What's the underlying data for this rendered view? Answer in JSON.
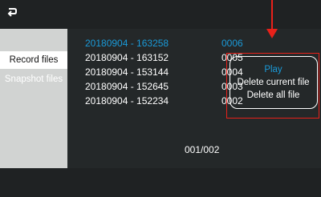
{
  "sidebar": {
    "tabs": [
      {
        "label": "Record files",
        "active": true
      },
      {
        "label": "Snapshot files",
        "active": false
      }
    ]
  },
  "files": [
    {
      "name": "20180904 - 163258",
      "index": "0006",
      "selected": true
    },
    {
      "name": "20180904 - 163152",
      "index": "0005",
      "selected": false
    },
    {
      "name": "20180904 - 153144",
      "index": "0004",
      "selected": false
    },
    {
      "name": "20180904 - 152645",
      "index": "0003",
      "selected": false
    },
    {
      "name": "20180904 - 152234",
      "index": "0002",
      "selected": false
    }
  ],
  "pagination": {
    "text": "001/002"
  },
  "context_menu": {
    "items": [
      {
        "label": "Play",
        "selected": true
      },
      {
        "label": "Delete current file",
        "selected": false
      },
      {
        "label": "Delete all file",
        "selected": false
      }
    ]
  },
  "colors": {
    "accent": "#1a9ad8",
    "annotation": "#e8211a",
    "background": "#202324",
    "sidebar": "#d1d3d2"
  },
  "icons": {
    "back": "back-arrow-icon"
  }
}
